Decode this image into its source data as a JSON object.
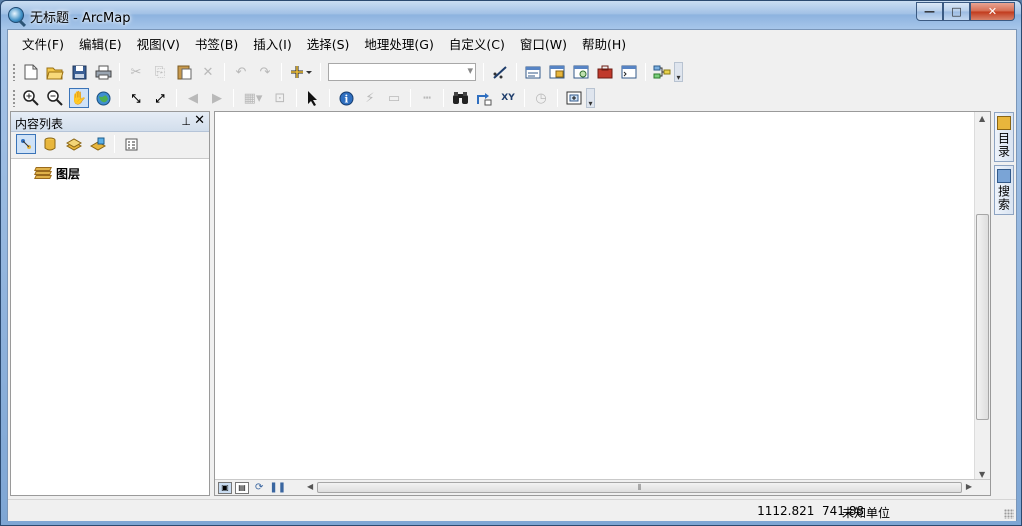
{
  "window": {
    "title": "无标题 - ArcMap",
    "controls": {
      "minimize": "—",
      "maximize": "□",
      "close": "✕"
    }
  },
  "menubar": {
    "items": [
      {
        "label": "文件(F)"
      },
      {
        "label": "编辑(E)"
      },
      {
        "label": "视图(V)"
      },
      {
        "label": "书签(B)"
      },
      {
        "label": "插入(I)"
      },
      {
        "label": "选择(S)"
      },
      {
        "label": "地理处理(G)"
      },
      {
        "label": "自定义(C)"
      },
      {
        "label": "窗口(W)"
      },
      {
        "label": "帮助(H)"
      }
    ]
  },
  "toolbar_standard": {
    "scale_combo_value": "",
    "icons": [
      "new-document-icon",
      "open-folder-icon",
      "save-icon",
      "print-icon",
      "cut-icon",
      "copy-icon",
      "paste-icon",
      "delete-icon",
      "undo-icon",
      "redo-icon",
      "add-data-icon",
      "editor-toolbar-icon",
      "layout-icon",
      "catalog-window-icon",
      "search-window-icon",
      "arctoolbox-icon",
      "python-window-icon",
      "model-builder-icon"
    ]
  },
  "toolbar_tools": {
    "icons": [
      "zoom-in-icon",
      "zoom-out-icon",
      "pan-hand-icon",
      "full-extent-globe-icon",
      "fixed-zoom-in-icon",
      "fixed-zoom-out-icon",
      "back-extent-icon",
      "forward-extent-icon",
      "select-features-icon",
      "clear-selection-icon",
      "select-elements-icon",
      "identify-icon",
      "hyperlink-icon",
      "html-popup-icon",
      "measure-icon",
      "find-binoculars-icon",
      "find-route-icon",
      "go-to-xy-icon",
      "time-slider-icon",
      "create-viewer-icon"
    ],
    "xy_label": "XY"
  },
  "toc": {
    "title": "内容列表",
    "pin_glyph": "ᵖ",
    "close_glyph": "✕",
    "layers_root": "图层"
  },
  "side_tabs": [
    {
      "label": "目录"
    },
    {
      "label": "搜索"
    }
  ],
  "status": {
    "coords": "1112.821  741.88",
    "units": "未知单位"
  },
  "colors": {
    "title_gradient_top": "#c9ddf2",
    "close_button": "#c1391b",
    "frame_bg": "#f0f0f0",
    "map_bg": "#ffffff"
  }
}
